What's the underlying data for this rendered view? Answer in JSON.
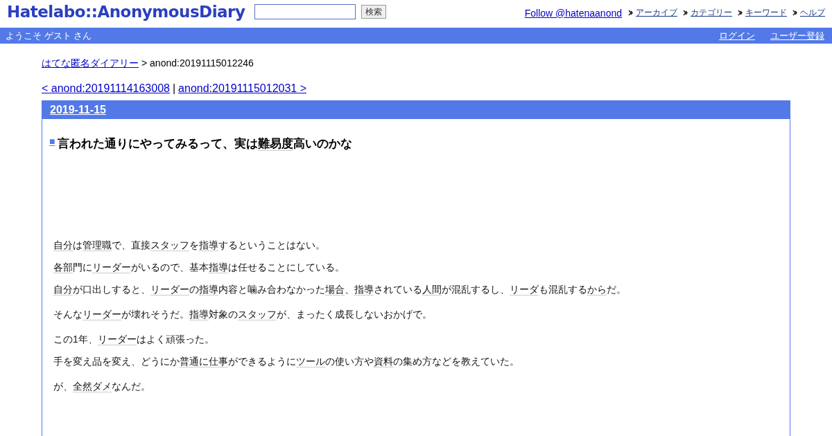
{
  "header": {
    "logo": "Hatelabo::AnonymousDiary",
    "search": {
      "button": "検索"
    },
    "follow": "Follow @hatenaanond",
    "nav": [
      "アーカイブ",
      "カテゴリー",
      "キーワード",
      "ヘルプ"
    ]
  },
  "userbar": {
    "welcome": "ようこそ ゲスト さん",
    "links": [
      "ログイン",
      "ユーザー登録"
    ]
  },
  "breadcrumb": {
    "home": "はてな匿名ダイアリー",
    "current": "> anond:20191115012246"
  },
  "pager": {
    "prev": "< anond:20191114163008",
    "separator": "|",
    "next": "anond:20191115012031 >"
  },
  "day": {
    "date": "2019-11-15",
    "title_mark": "■",
    "title": [
      {
        "text": "言われた通りにやってみるって、実は",
        "keyword": false
      },
      {
        "text": "難易度",
        "keyword": true
      },
      {
        "text": "高いのかな",
        "keyword": false
      }
    ],
    "sections": [
      [
        [
          {
            "text": "自分",
            "keyword": true
          },
          {
            "text": "は",
            "keyword": false
          },
          {
            "text": "管理職",
            "keyword": true
          },
          {
            "text": "で、直接",
            "keyword": false
          },
          {
            "text": "スタッフ",
            "keyword": true
          },
          {
            "text": "を",
            "keyword": false
          },
          {
            "text": "指導",
            "keyword": true
          },
          {
            "text": "するということはない。",
            "keyword": false
          }
        ],
        [
          {
            "text": "各部",
            "keyword": true
          },
          {
            "text": "門に",
            "keyword": false
          },
          {
            "text": "リーダー",
            "keyword": true
          },
          {
            "text": "がいるので、基本",
            "keyword": false
          },
          {
            "text": "指導",
            "keyword": true
          },
          {
            "text": "は任せることにしている。",
            "keyword": false
          }
        ],
        [
          {
            "text": "自分",
            "keyword": true
          },
          {
            "text": "が口出しすると、",
            "keyword": false
          },
          {
            "text": "リーダー",
            "keyword": true
          },
          {
            "text": "の",
            "keyword": false
          },
          {
            "text": "指導",
            "keyword": true
          },
          {
            "text": "内容と噛み合わなかった",
            "keyword": false
          },
          {
            "text": "場合",
            "keyword": true
          },
          {
            "text": "、",
            "keyword": false
          },
          {
            "text": "指導",
            "keyword": true
          },
          {
            "text": "されている",
            "keyword": false
          },
          {
            "text": "人間",
            "keyword": true
          },
          {
            "text": "が混乱するし、",
            "keyword": false
          },
          {
            "text": "リーダ",
            "keyword": true
          },
          {
            "text": "も混乱する",
            "keyword": false
          },
          {
            "text": "から",
            "keyword": true
          },
          {
            "text": "だ。",
            "keyword": false
          }
        ]
      ],
      [
        [
          {
            "text": "そんな",
            "keyword": false
          },
          {
            "text": "リーダー",
            "keyword": true
          },
          {
            "text": "が壊れそうだ。",
            "keyword": false
          },
          {
            "text": "指導",
            "keyword": true
          },
          {
            "text": "対象の",
            "keyword": false
          },
          {
            "text": "スタッフ",
            "keyword": true
          },
          {
            "text": "が、まったく成長しないおかげで。",
            "keyword": false
          }
        ]
      ],
      [
        [
          {
            "text": "この1年、",
            "keyword": false
          },
          {
            "text": "リーダー",
            "keyword": true
          },
          {
            "text": "はよく頑張った。",
            "keyword": false
          }
        ],
        [
          {
            "text": "手を変え品を変え、どうにか",
            "keyword": false
          },
          {
            "text": "普通に仕事",
            "keyword": true
          },
          {
            "text": "ができるように",
            "keyword": false
          },
          {
            "text": "ツール",
            "keyword": true
          },
          {
            "text": "の使い方や",
            "keyword": false
          },
          {
            "text": "資料",
            "keyword": true
          },
          {
            "text": "の集め方などを教えていた。",
            "keyword": false
          }
        ]
      ],
      [
        [
          {
            "text": "が、",
            "keyword": false
          },
          {
            "text": "全然ダメ",
            "keyword": true
          },
          {
            "text": "なんだ。",
            "keyword": false
          }
        ]
      ]
    ]
  }
}
